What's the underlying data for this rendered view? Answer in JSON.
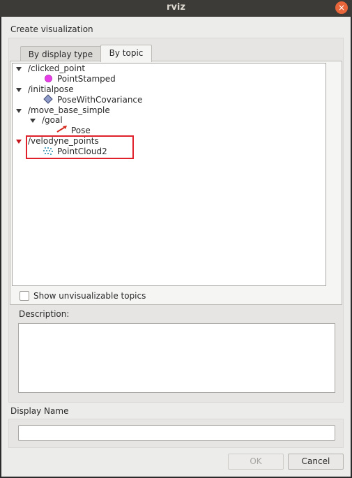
{
  "window": {
    "title": "rviz",
    "close_glyph": "×"
  },
  "dialog": {
    "heading": "Create visualization",
    "tabs": [
      {
        "label": "By display type",
        "active": false
      },
      {
        "label": "By topic",
        "active": true
      }
    ],
    "tree": [
      {
        "topic": "/clicked_point",
        "type": "PointStamped",
        "icon": "magenta-point-icon"
      },
      {
        "topic": "/initialpose",
        "type": "PoseWithCovariance",
        "icon": "pose-covariance-icon"
      },
      {
        "topic": "/move_base_simple",
        "subtopic": "/goal",
        "type": "Pose",
        "icon": "pose-arrow-icon"
      },
      {
        "topic": "/velodyne_points",
        "type": "PointCloud2",
        "icon": "pointcloud-icon"
      }
    ],
    "show_unvisualizable_label": "Show unvisualizable topics",
    "show_unvisualizable_checked": false,
    "description_label": "Description:",
    "description_value": "",
    "display_name_label": "Display Name",
    "display_name_value": "",
    "ok_label": "OK",
    "cancel_label": "Cancel"
  },
  "colors": {
    "highlight": "#e0202a",
    "point": "#e83ee8",
    "pose_arrow": "#d42b1e",
    "cloud": "#1b86a6"
  }
}
